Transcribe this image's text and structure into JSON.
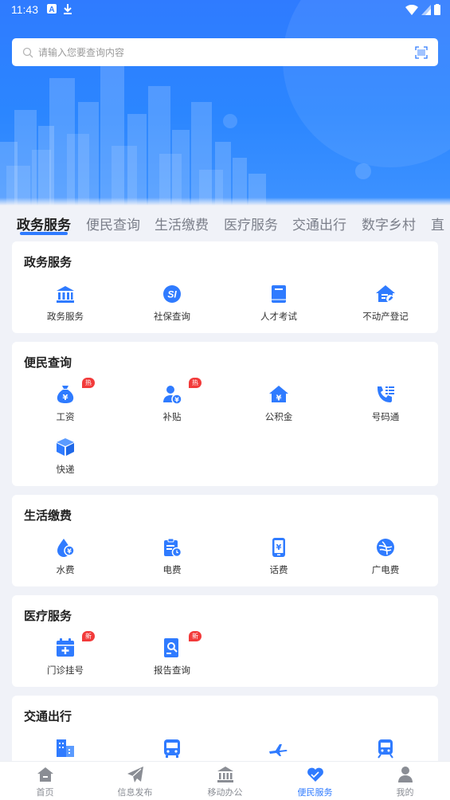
{
  "status": {
    "time": "11:43"
  },
  "search": {
    "placeholder": "请输入您要查询内容"
  },
  "tabs": [
    {
      "label": "政务服务",
      "active": true
    },
    {
      "label": "便民查询"
    },
    {
      "label": "生活缴费"
    },
    {
      "label": "医疗服务"
    },
    {
      "label": "交通出行"
    },
    {
      "label": "数字乡村"
    },
    {
      "label": "直"
    }
  ],
  "sections": [
    {
      "title": "政务服务",
      "items": [
        {
          "label": "政务服务",
          "icon": "bank-icon"
        },
        {
          "label": "社保查询",
          "icon": "social-security-icon"
        },
        {
          "label": "人才考试",
          "icon": "book-icon"
        },
        {
          "label": "不动产登记",
          "icon": "house-edit-icon"
        }
      ]
    },
    {
      "title": "便民查询",
      "items": [
        {
          "label": "工资",
          "icon": "money-bag-icon",
          "badge": "热"
        },
        {
          "label": "补贴",
          "icon": "person-yuan-icon",
          "badge": "热"
        },
        {
          "label": "公积金",
          "icon": "house-yuan-icon"
        },
        {
          "label": "号码通",
          "icon": "phone-list-icon"
        },
        {
          "label": "快递",
          "icon": "package-icon"
        }
      ]
    },
    {
      "title": "生活缴费",
      "items": [
        {
          "label": "水费",
          "icon": "water-drop-icon"
        },
        {
          "label": "电费",
          "icon": "clipboard-clock-icon"
        },
        {
          "label": "话费",
          "icon": "mobile-yuan-icon"
        },
        {
          "label": "广电费",
          "icon": "broadcast-icon"
        }
      ]
    },
    {
      "title": "医疗服务",
      "items": [
        {
          "label": "门诊挂号",
          "icon": "calendar-plus-icon",
          "badge": "新"
        },
        {
          "label": "报告查询",
          "icon": "report-search-icon",
          "badge": "新"
        }
      ]
    },
    {
      "title": "交通出行",
      "items": [
        {
          "label": "",
          "icon": "building-icon"
        },
        {
          "label": "",
          "icon": "bus-icon"
        },
        {
          "label": "",
          "icon": "airplane-icon"
        },
        {
          "label": "",
          "icon": "train-icon"
        }
      ]
    }
  ],
  "bottom_nav": [
    {
      "label": "首页",
      "icon": "home-icon"
    },
    {
      "label": "信息发布",
      "icon": "send-icon"
    },
    {
      "label": "移动办公",
      "icon": "office-building-icon"
    },
    {
      "label": "便民服务",
      "icon": "heart-hand-icon",
      "active": true
    },
    {
      "label": "我的",
      "icon": "user-icon"
    }
  ],
  "colors": {
    "accent": "#2f7bff",
    "badge": "#f23a3a",
    "background": "#f0f2f8"
  }
}
